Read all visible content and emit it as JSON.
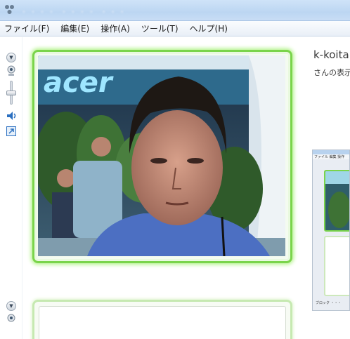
{
  "window": {
    "title": "・・・・ ・・・・ ・・・"
  },
  "menu": {
    "items": [
      {
        "label": "ファイル(F)"
      },
      {
        "label": "編集(E)"
      },
      {
        "label": "操作(A)"
      },
      {
        "label": "ツール(T)"
      },
      {
        "label": "ヘルプ(H)"
      }
    ]
  },
  "video": {
    "banner_text": "acer"
  },
  "contact": {
    "name": "k-koita",
    "status_text": "さんの表示"
  },
  "thumbnail": {
    "menu_text": "ファイル 編集 操作",
    "footer_text": "ブロック ・・・"
  },
  "colors": {
    "frame_green": "#7ad44b",
    "titlebar": "#bcd6f2"
  },
  "icons": {
    "app": "messenger-icon",
    "speaker": "speaker-icon",
    "webcam": "webcam-icon",
    "popout": "popout-icon"
  }
}
